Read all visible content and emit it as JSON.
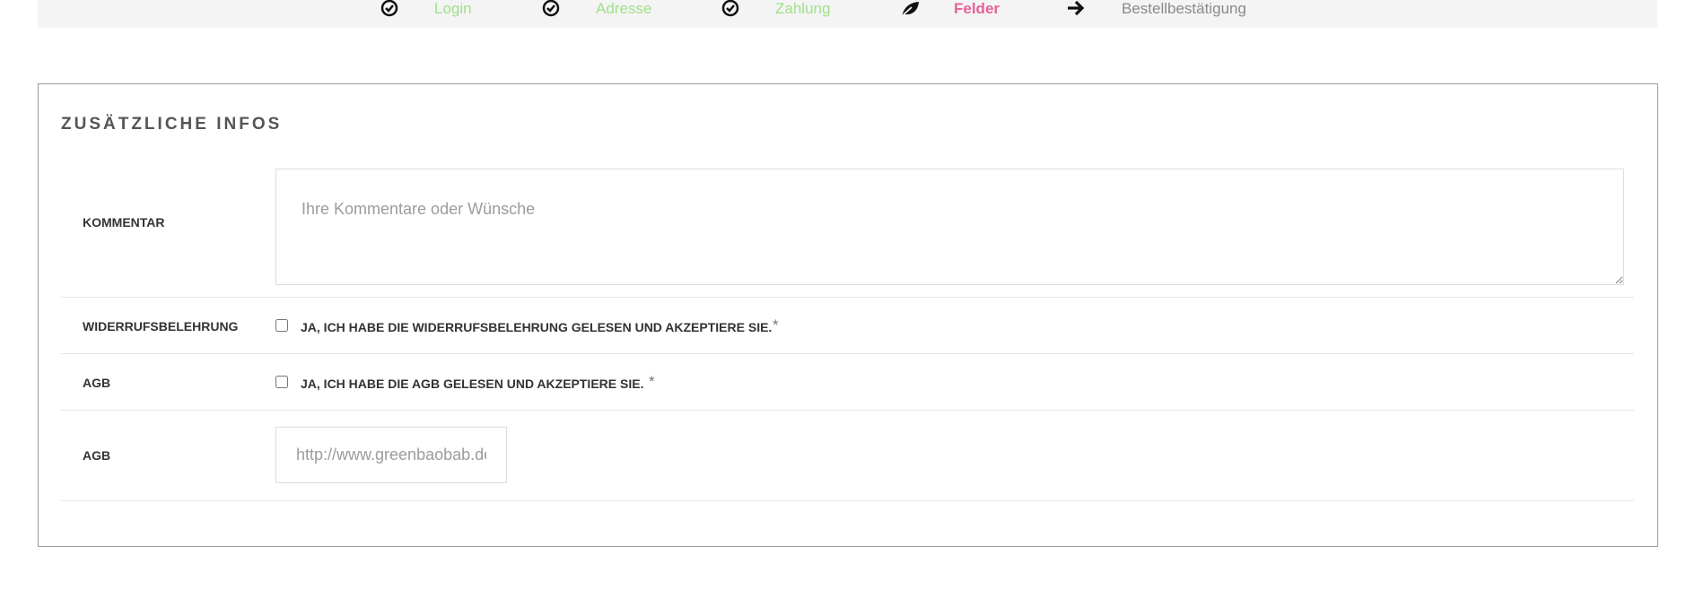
{
  "steps": [
    {
      "label": "Login",
      "state": "done",
      "icon": "check-circle-icon"
    },
    {
      "label": "Adresse",
      "state": "done",
      "icon": "check-circle-icon"
    },
    {
      "label": "Zahlung",
      "state": "done",
      "icon": "check-circle-icon"
    },
    {
      "label": "Felder",
      "state": "active",
      "icon": "leaf-icon"
    },
    {
      "label": "Bestellbestätigung",
      "state": "todo",
      "icon": "arrow-right-icon"
    }
  ],
  "colors": {
    "done": "#9fe08a",
    "active": "#e8619a",
    "todo": "#8a8a8a"
  },
  "panel": {
    "title": "ZUSÄTZLICHE INFOS",
    "comment": {
      "label": "KOMMENTAR",
      "placeholder": "Ihre Kommentare oder Wünsche"
    },
    "withdrawal": {
      "label": "WIDERRUFSBELEHRUNG",
      "checkbox_text": "JA, ICH HABE DIE WIDERRUFSBELEHRUNG GELESEN UND AKZEPTIERE SIE.",
      "required_mark": "*"
    },
    "agb_check": {
      "label": "AGB",
      "checkbox_text": "JA, ICH HABE DIE AGB GELESEN UND AKZEPTIERE SIE.",
      "required_mark": "*"
    },
    "agb_link": {
      "label": "AGB",
      "value": "http://www.greenbaobab.de"
    }
  }
}
